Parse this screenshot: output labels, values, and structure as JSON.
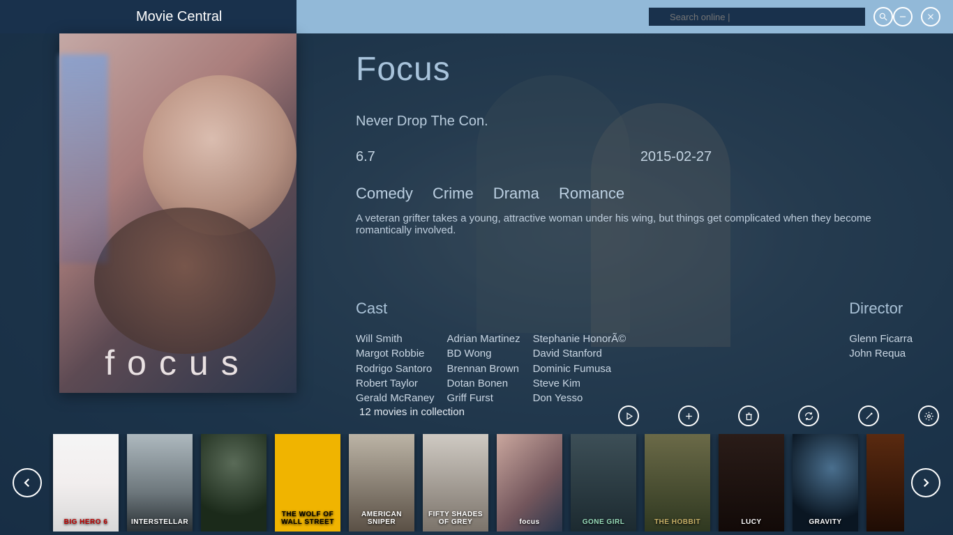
{
  "app": {
    "title": "Movie Central"
  },
  "search": {
    "placeholder": "Search online |"
  },
  "movie": {
    "title": "Focus",
    "poster_title": "focus",
    "tagline": "Never Drop The Con.",
    "rating": "6.7",
    "release_date": "2015-02-27",
    "genres": [
      "Comedy",
      "Crime",
      "Drama",
      "Romance"
    ],
    "synopsis": "A veteran grifter takes a young, attractive woman under his wing, but things get complicated when they become romantically involved."
  },
  "credits": {
    "cast_label": "Cast",
    "cast": [
      [
        "Will Smith",
        "Margot Robbie",
        "Rodrigo Santoro",
        "Robert Taylor",
        "Gerald McRaney"
      ],
      [
        "Adrian Martinez",
        "BD Wong",
        "Brennan Brown",
        "Dotan Bonen",
        "Griff Furst"
      ],
      [
        "Stephanie HonorÃ©",
        "David Stanford",
        "Dominic Fumusa",
        "Steve Kim",
        "Don Yesso"
      ]
    ],
    "director_label": "Director",
    "directors": [
      "Glenn Ficarra",
      "John Requa"
    ]
  },
  "collection": {
    "count_text": "12 movies in collection"
  },
  "thumbnails": [
    {
      "label": "BIG HERO 6",
      "bg": "linear-gradient(180deg,#f5f5f5 0%,#f2eeee 50%,#d8d8d8 100%)",
      "text": "#b00"
    },
    {
      "label": "INTERSTELLAR",
      "bg": "linear-gradient(180deg,#aeb9bf 0%,#6d777c 60%,#2b3236 100%)",
      "text": "#fff"
    },
    {
      "label": "",
      "bg": "radial-gradient(circle at 50% 30%,#5a6b58 0%,#1b2a1a 70%)",
      "text": "#fff"
    },
    {
      "label": "THE WOLF OF WALL STREET",
      "bg": "#f0b400",
      "text": "#000"
    },
    {
      "label": "AMERICAN SNIPER",
      "bg": "linear-gradient(180deg,#bcb4a6 0%,#5a5045 100%)",
      "text": "#fff"
    },
    {
      "label": "FIFTY SHADES OF GREY",
      "bg": "linear-gradient(180deg,#cfcac3 0%,#7b736a 100%)",
      "text": "#fff"
    },
    {
      "label": "focus",
      "bg": "linear-gradient(135deg,#caa79e 0%,#73565c 60%,#2a364c 100%)",
      "text": "#fff"
    },
    {
      "label": "GONE GIRL",
      "bg": "linear-gradient(180deg,#3d4f57 0%,#1c2a30 100%)",
      "text": "#9db"
    },
    {
      "label": "THE HOBBIT",
      "bg": "linear-gradient(180deg,#6b6a48 0%,#2f3820 100%)",
      "text": "#c7b067"
    },
    {
      "label": "LUCY",
      "bg": "linear-gradient(180deg,#2a1c18 0%,#120a08 100%)",
      "text": "#fff"
    },
    {
      "label": "GRAVITY",
      "bg": "radial-gradient(circle at 60% 35%,#4a6f8e 0%,#0a1622 70%)",
      "text": "#fff"
    },
    {
      "label": "",
      "bg": "linear-gradient(180deg,#5a2a10 0%,#1f0c04 100%)",
      "text": "#fff"
    }
  ]
}
